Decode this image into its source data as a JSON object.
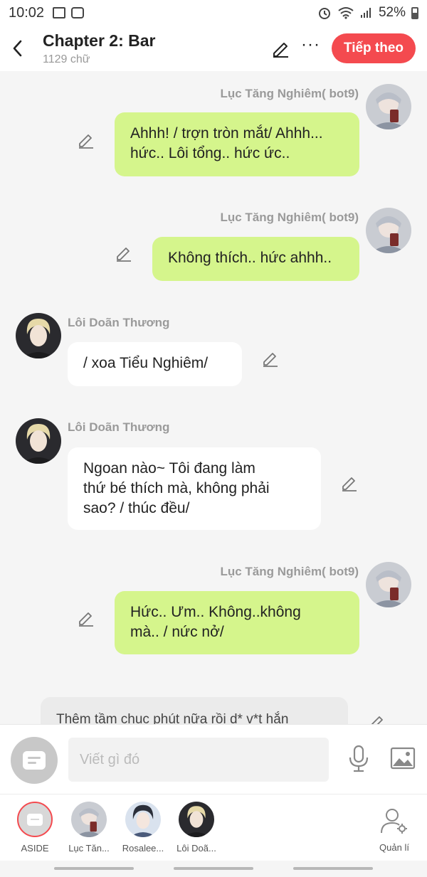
{
  "status_bar": {
    "time": "10:02",
    "battery": "52%"
  },
  "header": {
    "title": "Chapter 2: Bar",
    "subtitle": "1129 chữ",
    "next_label": "Tiếp theo"
  },
  "messages": [
    {
      "sender": "Lục Tăng Nghiêm( bot9)",
      "text": "Ahhh! / trợn tròn mắt/ Ahhh...\nhức.. Lôi tổng.. hức ức..",
      "side": "right"
    },
    {
      "sender": "Lục Tăng Nghiêm( bot9)",
      "text": "Không thích.. hức ahhh..",
      "side": "right"
    },
    {
      "sender": "Lôi Doãn Thương",
      "text": "/ xoa Tiểu Nghiêm/",
      "side": "left"
    },
    {
      "sender": "Lôi Doãn Thương",
      "text": "Ngoan nào~ Tôi đang làm\nthứ bé thích mà, không phải\nsao? / thúc đều/",
      "side": "left"
    },
    {
      "sender": "Lục Tăng Nghiêm( bot9)",
      "text": "Hức.. Ưm.. Không..không\nmà.. / nức nở/",
      "side": "right"
    },
    {
      "sender": "",
      "text": "Thêm tầm chục phút nữa rồi d* v*t hắn",
      "side": "narration"
    }
  ],
  "compose": {
    "placeholder": "Viết gì đó"
  },
  "characters": [
    {
      "label": "ASIDE"
    },
    {
      "label": "Lục Tăn..."
    },
    {
      "label": "Rosalee..."
    },
    {
      "label": "Lôi Doã..."
    }
  ],
  "manage_label": "Quản lí",
  "colors": {
    "accent": "#f44a4f",
    "bubble_right": "#d5f58c",
    "bubble_left": "#ffffff"
  }
}
